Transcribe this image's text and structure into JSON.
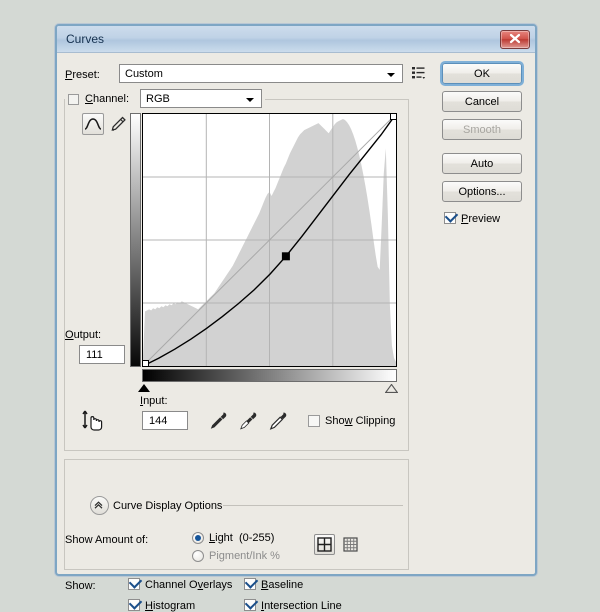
{
  "window": {
    "title": "Curves",
    "close_label": "✕"
  },
  "preset": {
    "label": "Preset:",
    "value": "Custom",
    "menu_icon": "preset-menu-icon"
  },
  "channel": {
    "label": "Channel:",
    "value": "RGB"
  },
  "tools": {
    "curve_tool": "curve-tool-icon",
    "pencil_tool": "pencil-tool-icon",
    "target_adjust": "on-image-adjust-icon",
    "dropper_black": "black-point-eyedropper-icon",
    "dropper_gray": "gray-point-eyedropper-icon",
    "dropper_white": "white-point-eyedropper-icon"
  },
  "fields": {
    "output_label": "Output:",
    "output_value": "111",
    "input_label": "Input:",
    "input_value": "144"
  },
  "show_clipping": {
    "label": "Show Clipping",
    "checked": false
  },
  "curve_display_options": {
    "title": "Curve Display Options",
    "show_amount_label": "Show Amount of:",
    "radios": [
      {
        "label": "Light  (0-255)",
        "selected": true
      },
      {
        "label": "Pigment/Ink %",
        "selected": false
      }
    ],
    "grid_buttons": [
      {
        "name": "coarse-grid-button",
        "selected": true
      },
      {
        "name": "fine-grid-button",
        "selected": false
      }
    ],
    "show_label": "Show:",
    "checkboxes": [
      {
        "label": "Channel Overlays",
        "checked": true
      },
      {
        "label": "Baseline",
        "checked": true
      },
      {
        "label": "Histogram",
        "checked": true
      },
      {
        "label": "Intersection Line",
        "checked": true
      }
    ]
  },
  "buttons": {
    "ok": "OK",
    "cancel": "Cancel",
    "smooth": "Smooth",
    "auto": "Auto",
    "options": "Options...",
    "preview_label": "Preview",
    "preview_checked": true
  },
  "colors": {
    "accent": "#7ea6c4",
    "titlebar": "#bfd2e6",
    "dialog_bg": "#eceae4",
    "page_bg": "#d4d9d4",
    "close_red": "#d2554c",
    "curve_stroke": "#000000",
    "baseline_stroke": "#a9a9a9",
    "histogram_fill": "#d0d0d0"
  },
  "chart_data": {
    "type": "line",
    "title": "RGB Tone Curve",
    "xlabel": "Input",
    "ylabel": "Output",
    "xlim": [
      0,
      255
    ],
    "ylim": [
      0,
      255
    ],
    "grid": true,
    "grid_divisions": 4,
    "control_points": [
      {
        "input": 0,
        "output": 0
      },
      {
        "input": 144,
        "output": 111
      },
      {
        "input": 255,
        "output": 255
      }
    ],
    "selected_point": {
      "input": 144,
      "output": 111
    },
    "baseline": [
      [
        0,
        0
      ],
      [
        255,
        255
      ]
    ],
    "curve_samples": [
      [
        0,
        0
      ],
      [
        16,
        8
      ],
      [
        32,
        17
      ],
      [
        48,
        27
      ],
      [
        64,
        38
      ],
      [
        80,
        50
      ],
      [
        96,
        63
      ],
      [
        112,
        77
      ],
      [
        128,
        93
      ],
      [
        144,
        111
      ],
      [
        160,
        131
      ],
      [
        176,
        152
      ],
      [
        192,
        173
      ],
      [
        208,
        194
      ],
      [
        224,
        214
      ],
      [
        240,
        234
      ],
      [
        255,
        255
      ]
    ],
    "histogram": [
      10,
      54,
      55,
      56,
      55,
      57,
      56,
      58,
      57,
      59,
      58,
      60,
      59,
      61,
      60,
      62,
      61,
      63,
      62,
      64,
      63,
      62,
      61,
      60,
      59,
      58,
      57,
      56,
      58,
      60,
      62,
      64,
      66,
      68,
      70,
      72,
      75,
      78,
      81,
      84,
      87,
      90,
      93,
      96,
      99,
      103,
      107,
      111,
      115,
      119,
      123,
      127,
      131,
      135,
      139,
      143,
      147,
      151,
      156,
      161,
      166,
      170,
      172,
      168,
      172,
      176,
      181,
      186,
      191,
      196,
      200,
      205,
      210,
      214,
      218,
      222,
      226,
      229,
      231,
      233,
      234,
      235,
      236,
      237,
      238,
      239,
      240,
      238,
      236,
      234,
      232,
      230,
      233,
      236,
      239,
      241,
      242,
      243,
      244,
      243,
      241,
      238,
      234,
      229,
      223,
      216,
      208,
      199,
      189,
      178,
      166,
      153,
      139,
      124,
      110,
      98,
      95,
      140,
      190,
      215,
      150,
      60,
      20,
      8,
      4
    ]
  }
}
